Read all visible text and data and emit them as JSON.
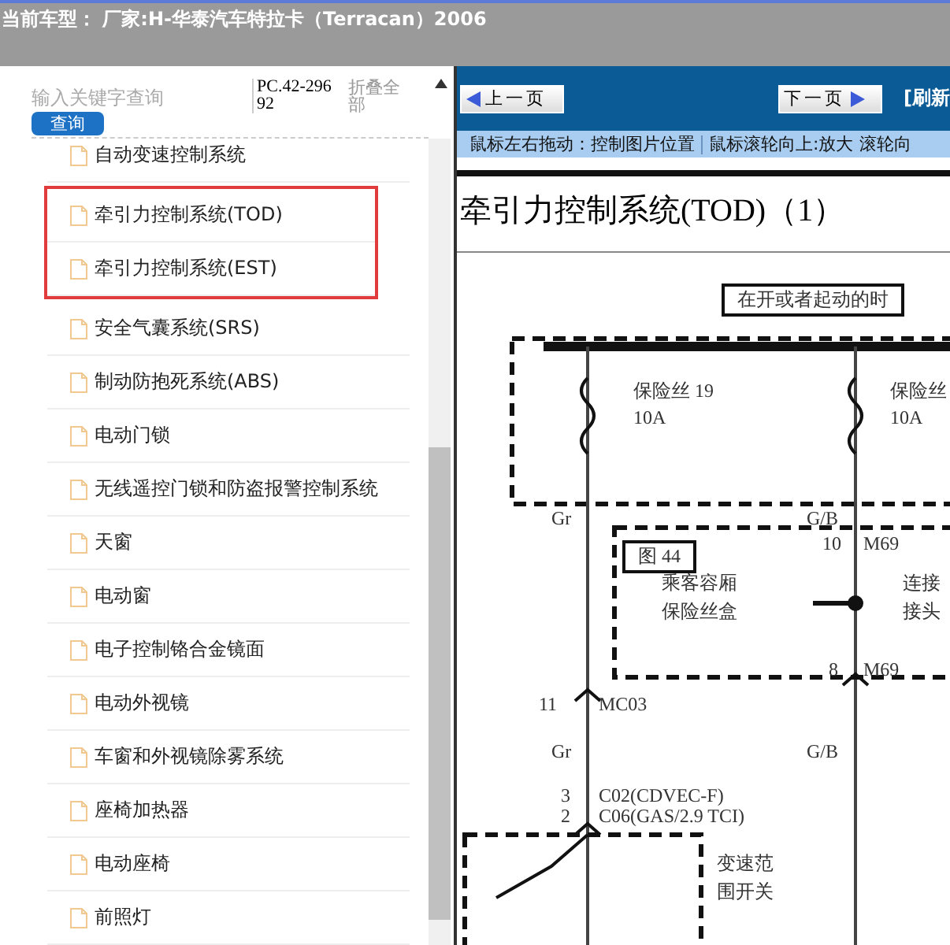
{
  "header": {
    "title": "当前车型：  厂家:H-华泰汽车特拉卡（Terracan）2006"
  },
  "search": {
    "placeholder": "输入关键字查询",
    "button": "查询"
  },
  "code": "PC.42-29692",
  "collapse_all": "折叠全部",
  "items": [
    {
      "label": "自动变速控制系统",
      "highlighted": false
    },
    {
      "label": "牵引力控制系统(TOD)",
      "highlighted": true
    },
    {
      "label": "牵引力控制系统(EST)",
      "highlighted": true
    },
    {
      "label": "安全气囊系统(SRS)",
      "highlighted": false
    },
    {
      "label": "制动防抱死系统(ABS)",
      "highlighted": false
    },
    {
      "label": "电动门锁",
      "highlighted": false
    },
    {
      "label": "无线遥控门锁和防盗报警控制系统",
      "highlighted": false
    },
    {
      "label": "天窗",
      "highlighted": false
    },
    {
      "label": "电动窗",
      "highlighted": false
    },
    {
      "label": "电子控制铬合金镜面",
      "highlighted": false
    },
    {
      "label": "电动外视镜",
      "highlighted": false
    },
    {
      "label": "车窗和外视镜除雾系统",
      "highlighted": false
    },
    {
      "label": "座椅加热器",
      "highlighted": false
    },
    {
      "label": "电动座椅",
      "highlighted": false
    },
    {
      "label": "前照灯",
      "highlighted": false
    }
  ],
  "viewer": {
    "prev_button": "上一页",
    "next_button": "下一页",
    "refresh": "[刷新",
    "hints": [
      "鼠标左右拖动：控制图片位置",
      "鼠标滚轮向上:放大",
      "滚轮向"
    ],
    "diagram_title": "牵引力控制系统(TOD)（1）",
    "diagram_labels": [
      "在开或者起动的时",
      "保险丝 19",
      "10A",
      "保险丝",
      "10A",
      "Gr",
      "G/B",
      "图 44",
      "乘客容厢",
      "保险丝盒",
      "10",
      "M69",
      "连接",
      "接头",
      "8",
      "M69",
      "11",
      "MC03",
      "Gr",
      "G/B",
      "3",
      "C02(CDVEC-F)",
      "2",
      "C06(GAS/2.9 TCI)",
      "变速范",
      "围开关"
    ]
  }
}
